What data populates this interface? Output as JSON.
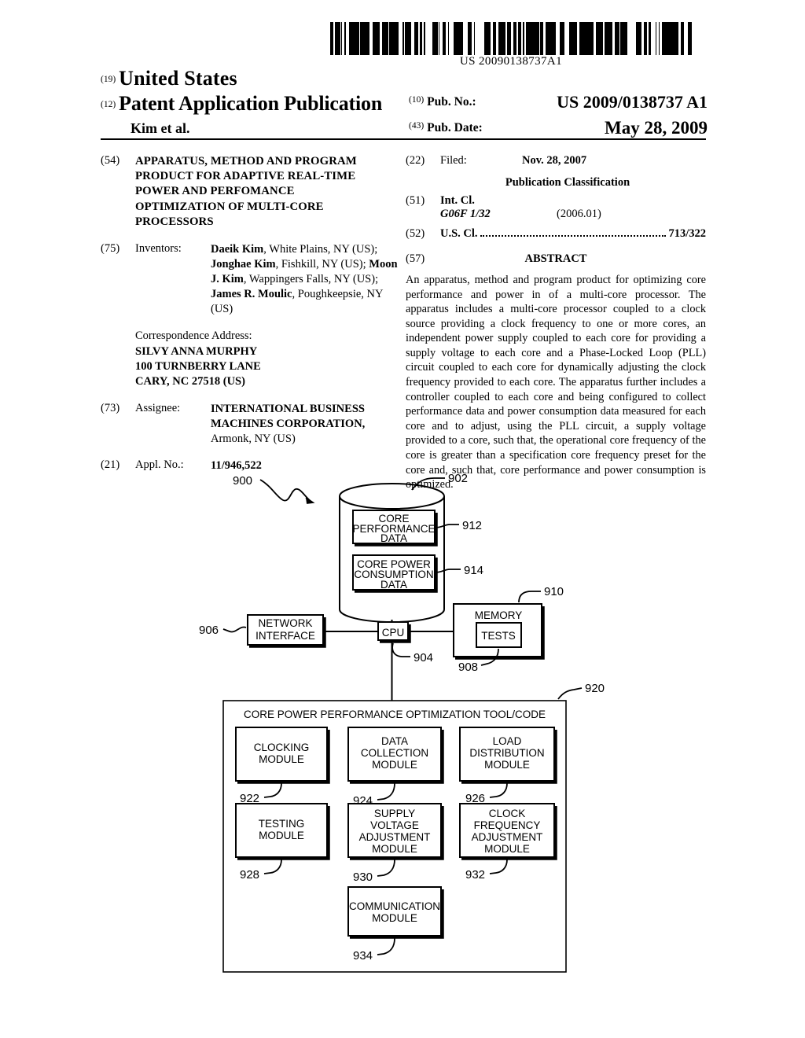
{
  "header": {
    "pub_number_barcode_text": "US 20090138737A1",
    "country_code": "(19)",
    "country": "United States",
    "doc_code": "(12)",
    "doc_type": "Patent Application Publication",
    "applicant_short": "Kim et al.",
    "pubno_code": "(10)",
    "pubno_label": "Pub. No.:",
    "pubno_value": "US 2009/0138737 A1",
    "pubdate_code": "(43)",
    "pubdate_label": "Pub. Date:",
    "pubdate_value": "May 28, 2009"
  },
  "left_column": {
    "title_code": "(54)",
    "title_lines": [
      "APPARATUS, METHOD AND PROGRAM",
      "PRODUCT FOR ADAPTIVE REAL-TIME",
      "POWER AND PERFOMANCE",
      "OPTIMIZATION OF MULTI-CORE",
      "PROCESSORS"
    ],
    "inventors_code": "(75)",
    "inventors_label": "Inventors:",
    "inventors_html": "<b>Daeik Kim</b>, White Plains, NY (US); <b>Jonghae Kim</b>, Fishkill, NY (US); <b>Moon J. Kim</b>, Wappingers Falls, NY (US); <b>James R. Moulic</b>, Poughkeepsie, NY (US)",
    "correspondence_label": "Correspondence Address:",
    "correspondence_lines": [
      "SILVY ANNA MURPHY",
      "100 TURNBERRY LANE",
      "CARY, NC 27518 (US)"
    ],
    "assignee_code": "(73)",
    "assignee_label": "Assignee:",
    "assignee_name_line1": "INTERNATIONAL BUSINESS",
    "assignee_name_line2": "MACHINES CORPORATION,",
    "assignee_city": "Armonk, NY (US)",
    "applno_code": "(21)",
    "applno_label": "Appl. No.:",
    "applno_value": "11/946,522"
  },
  "right_column": {
    "filed_code": "(22)",
    "filed_label": "Filed:",
    "filed_value": "Nov. 28, 2007",
    "pub_classification_heading": "Publication Classification",
    "intcl_code": "(51)",
    "intcl_label": "Int. Cl.",
    "intcl_value": "G06F  1/32",
    "intcl_version": "(2006.01)",
    "uscl_code": "(52)",
    "uscl_label": "U.S. Cl.",
    "uscl_value": "713/322",
    "abstract_code": "(57)",
    "abstract_heading": "ABSTRACT",
    "abstract_text": "An apparatus, method and program product for optimizing core performance and power in of a multi-core processor. The apparatus includes a multi-core processor coupled to a clock source providing a clock frequency to one or more cores, an independent power supply coupled to each core for providing a supply voltage to each core and a Phase-Locked Loop (PLL) circuit coupled to each core for dynamically adjusting the clock frequency provided to each core. The apparatus further includes a controller coupled to each core and being configured to collect performance data and power consumption data measured for each core and to adjust, using the PLL circuit, a supply voltage provided to a core, such that, the operational core frequency of the core is greater than a specification core frequency preset for the core and, such that, core performance and power consumption is optimized."
  },
  "figure": {
    "system_ref": "900",
    "storage_ref": "902",
    "cpu_label": "CPU",
    "cpu_ref": "904",
    "network_interface_label_line1": "NETWORK",
    "network_interface_label_line2": "INTERFACE",
    "network_interface_ref": "906",
    "tests_label": "TESTS",
    "tests_ref": "908",
    "memory_label": "MEMORY",
    "memory_ref": "910",
    "core_performance_data_lines": [
      "CORE",
      "PERFORMANCE",
      "DATA"
    ],
    "core_performance_data_ref": "912",
    "core_power_consumption_lines": [
      "CORE POWER",
      "CONSUMPTION",
      "DATA"
    ],
    "core_power_consumption_ref": "914",
    "tool_title": "CORE POWER PERFORMANCE OPTIMIZATION TOOL/CODE",
    "tool_ref": "920",
    "modules": [
      {
        "lines": [
          "CLOCKING",
          "MODULE"
        ],
        "ref": "922"
      },
      {
        "lines": [
          "DATA",
          "COLLECTION",
          "MODULE"
        ],
        "ref": "924"
      },
      {
        "lines": [
          "LOAD",
          "DISTRIBUTION",
          "MODULE"
        ],
        "ref": "926"
      },
      {
        "lines": [
          "TESTING",
          "MODULE"
        ],
        "ref": "928"
      },
      {
        "lines": [
          "SUPPLY",
          "VOLTAGE",
          "ADJUSTMENT",
          "MODULE"
        ],
        "ref": "930"
      },
      {
        "lines": [
          "CLOCK",
          "FREQUENCY",
          "ADJUSTMENT",
          "MODULE"
        ],
        "ref": "932"
      },
      {
        "lines": [
          "COMMUNICATION",
          "MODULE"
        ],
        "ref": "934"
      }
    ]
  }
}
